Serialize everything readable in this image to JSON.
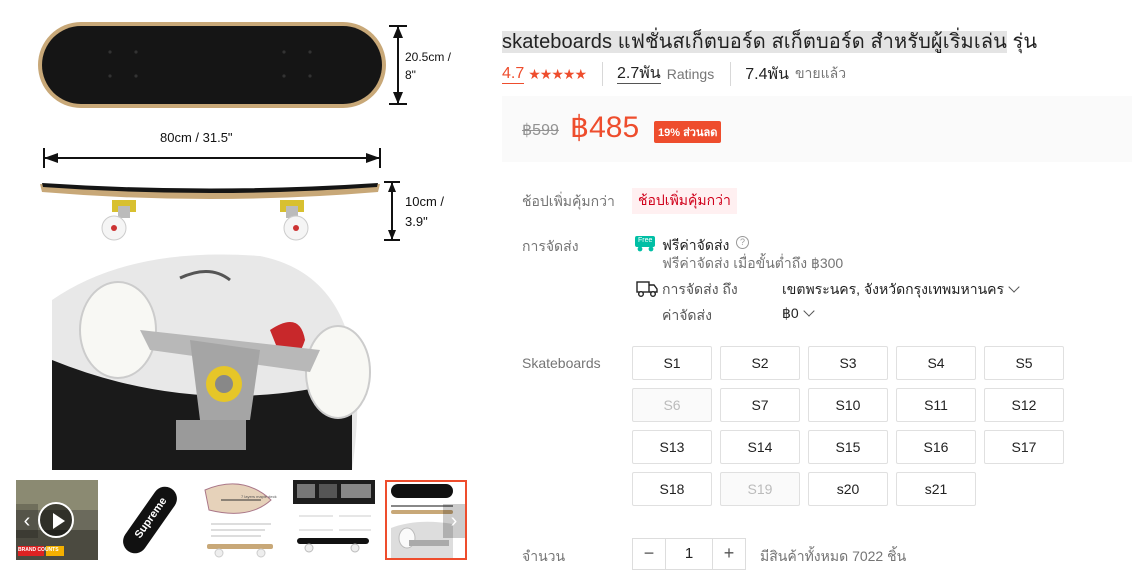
{
  "gallery": {
    "dimensions": {
      "width_top": "20.5cm /",
      "width_bottom": "8\"",
      "length": "80cm / 31.5\"",
      "height_top": "10cm /",
      "height_bottom": "3.9\""
    },
    "thumb_badge": "BRAND COUNTS",
    "thumb_brand_text": "Supreme",
    "thumb_caption": "7 layers maple deck"
  },
  "product": {
    "title_highlighted": "skateboards แฟชั่นสเก็ตบอร์ด สเก็ตบอร์ด สำหรับผู้เริ่มเล่น",
    "title_rest": " รุ่น",
    "rating": "4.7",
    "stars": "★★★★★",
    "ratings_count": "2.7พัน",
    "ratings_label": "Ratings",
    "sold_count": "7.4พัน",
    "sold_label": "ขายแล้ว"
  },
  "price": {
    "original": "฿599",
    "current": "฿485",
    "discount": "19% ส่วนลด"
  },
  "deals": {
    "label": "ช้อปเพิ่มคุ้มกว่า",
    "badge": "ช้อปเพิ่มคุ้มกว่า"
  },
  "shipping": {
    "label": "การจัดส่ง",
    "free_icon_text": "Free",
    "free_title": "ฟรีค่าจัดส่ง",
    "free_sub": "ฟรีค่าจัดส่ง เมื่อขั้นต่ำถึง ฿300",
    "to_label": "การจัดส่ง ถึง",
    "to_value": "เขตพระนคร, จังหวัดกรุงเทพมหานคร",
    "fee_label": "ค่าจัดส่ง",
    "fee_value": "฿0"
  },
  "variations": {
    "label": "Skateboards",
    "options": [
      {
        "label": "S1",
        "disabled": false
      },
      {
        "label": "S2",
        "disabled": false
      },
      {
        "label": "S3",
        "disabled": false
      },
      {
        "label": "S4",
        "disabled": false
      },
      {
        "label": "S5",
        "disabled": false
      },
      {
        "label": "S6",
        "disabled": true
      },
      {
        "label": "S7",
        "disabled": false
      },
      {
        "label": "S10",
        "disabled": false
      },
      {
        "label": "S11",
        "disabled": false
      },
      {
        "label": "S12",
        "disabled": false
      },
      {
        "label": "S13",
        "disabled": false
      },
      {
        "label": "S14",
        "disabled": false
      },
      {
        "label": "S15",
        "disabled": false
      },
      {
        "label": "S16",
        "disabled": false
      },
      {
        "label": "S17",
        "disabled": false
      },
      {
        "label": "S18",
        "disabled": false
      },
      {
        "label": "S19",
        "disabled": true
      },
      {
        "label": "s20",
        "disabled": false
      },
      {
        "label": "s21",
        "disabled": false
      }
    ]
  },
  "quantity": {
    "label": "จำนวน",
    "minus": "−",
    "value": "1",
    "plus": "+",
    "stock": "มีสินค้าทั้งหมด 7022 ชิ้น"
  },
  "colors": {
    "accent": "#ee4d2d",
    "deal_bg": "#fff0f1",
    "deal_text": "#d0011b"
  },
  "icons": [
    "free-shipping-icon",
    "help-icon",
    "truck-icon",
    "chevron-down-icon",
    "play-icon",
    "chevron-left-icon",
    "chevron-right-icon"
  ]
}
